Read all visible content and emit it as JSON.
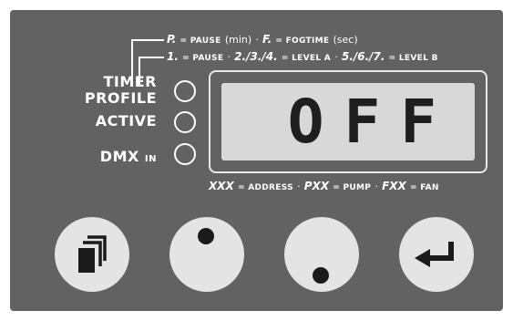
{
  "legend": {
    "line1": {
      "p_key": "P.",
      "p_desc": "= PAUSE",
      "p_unit": "(min)",
      "sep": "·",
      "f_key": "F.",
      "f_desc": "= FOGTIME",
      "f_unit": "(sec)"
    },
    "line2": {
      "k1": "1.",
      "d1": "= PAUSE",
      "sep1": "·",
      "k2": "2./3./4.",
      "d2": "= LEVEL A",
      "sep2": "·",
      "k3": "5./6./7.",
      "d3": "= LEVEL B"
    },
    "line3": {
      "k1": "XXX",
      "d1": "= ADDRESS",
      "sep1": "·",
      "k2": "PXX",
      "d2": "= PUMP",
      "sep2": "·",
      "k3": "FXX",
      "d3": "= FAN"
    }
  },
  "indicators": {
    "timer_label": "TIMER",
    "profile_label": "PROFILE",
    "active_label": "ACTIVE",
    "dmx_label": "DMX",
    "dmx_sub": "IN"
  },
  "display": {
    "text": "OFF"
  },
  "buttons": {
    "menu_icon": "menu-icon",
    "up_icon": "dot-up-icon",
    "down_icon": "dot-down-icon",
    "enter_icon": "enter-icon"
  },
  "colors": {
    "panel": "#626262",
    "display_bg": "#d8d8d8",
    "button": "#e4e4e4",
    "icon": "#1b1b1b"
  }
}
